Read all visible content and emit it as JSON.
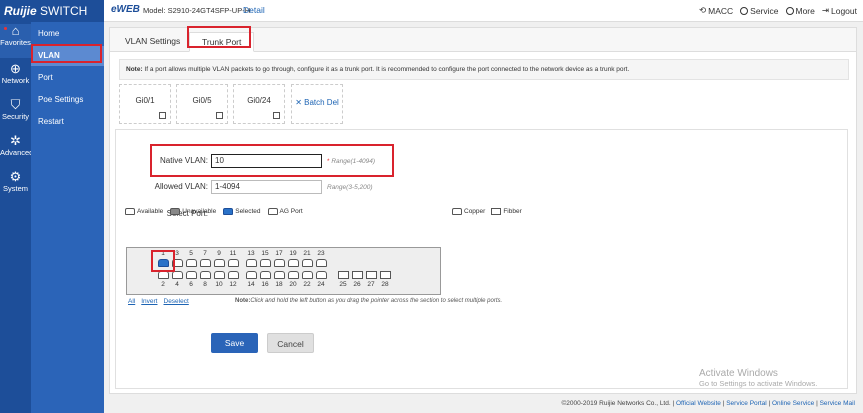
{
  "header": {
    "brand": "Ruijie",
    "brand_suffix": "SWITCH",
    "eweb": "eWEB",
    "model": "Model: S2910-24GT4SFP-UP-H",
    "detail": "Detail",
    "macc": "MACC",
    "service": "Service",
    "more": "More",
    "logout": "Logout"
  },
  "rail": [
    {
      "label": "Favorites",
      "icon": "home-icon"
    },
    {
      "label": "Network",
      "icon": "globe-icon"
    },
    {
      "label": "Security",
      "icon": "shield-icon"
    },
    {
      "label": "Advanced",
      "icon": "gear-icon"
    },
    {
      "label": "System",
      "icon": "settings-icon"
    }
  ],
  "submenu": [
    "Home",
    "VLAN",
    "Port",
    "Poe Settings",
    "Restart"
  ],
  "tabs": [
    "VLAN Settings",
    "Trunk Port"
  ],
  "note": {
    "prefix": "Note:",
    "text": "If a port allows multiple VLAN packets to go through, configure it as a trunk port. It is recommended to configure the port connected to the network device as a trunk port."
  },
  "trunk_ports": [
    "Gi0/1",
    "Gi0/5",
    "Gi0/24"
  ],
  "batch_del": "Batch Del",
  "form": {
    "native_vlan_label": "Native VLAN:",
    "native_vlan_value": "10",
    "native_vlan_required": "*",
    "native_vlan_hint": "Range(1-4094)",
    "allowed_vlan_label": "Allowed VLAN:",
    "allowed_vlan_value": "1-4094",
    "allowed_vlan_hint": "Range(3-5,200)",
    "select_port_label": "Select Port:"
  },
  "legend": {
    "available": "Available",
    "unavailable": "Unavailable",
    "selected": "Selected",
    "ag_port": "AG Port",
    "copper": "Copper",
    "fibber": "Fibber"
  },
  "ports_top": [
    "1",
    "3",
    "5",
    "7",
    "9",
    "11",
    "13",
    "15",
    "17",
    "19",
    "21",
    "23"
  ],
  "ports_bottom": [
    "2",
    "4",
    "6",
    "8",
    "10",
    "12",
    "14",
    "16",
    "18",
    "20",
    "22",
    "24"
  ],
  "ports_fiber": [
    "25",
    "26",
    "27",
    "28"
  ],
  "selected_ports": [
    "1"
  ],
  "links": {
    "all": "All",
    "invert": "Invert",
    "deselect": "Deselect"
  },
  "panel_note": {
    "prefix": "Note:",
    "text": "Click and hold the left button as you drag the pointer across the section to select multiple ports."
  },
  "buttons": {
    "save": "Save",
    "cancel": "Cancel"
  },
  "footer": {
    "copyright": "©2000-2019 Ruijie Networks Co., Ltd.",
    "links": [
      "Official Website",
      "Service Portal",
      "Online Service",
      "Service Mail"
    ]
  },
  "watermark": {
    "title": "Activate Windows",
    "sub": "Go to Settings to activate Windows."
  },
  "colors": {
    "sidebar": "#1d4e99",
    "submenu": "#2b64b8",
    "accent": "#2a64b8",
    "highlight": "#d9232d"
  }
}
